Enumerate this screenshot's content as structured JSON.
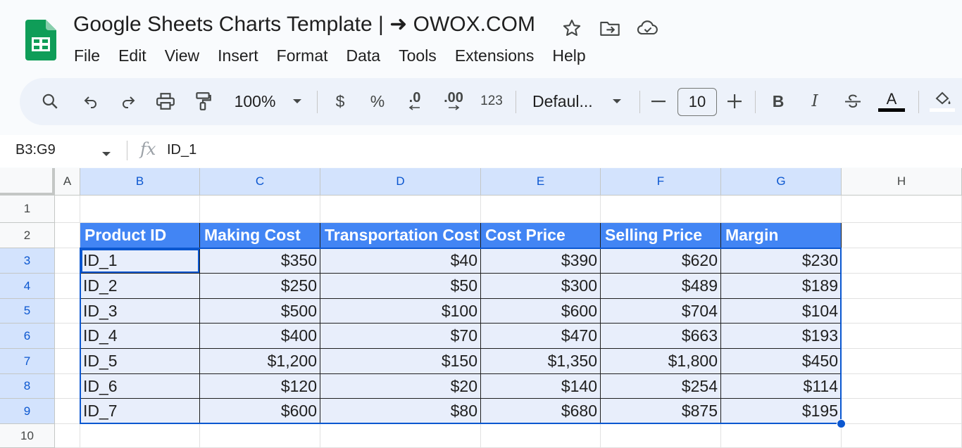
{
  "app": {
    "title": "Google Sheets Charts Template | ➜ OWOX.COM",
    "menu": [
      "File",
      "Edit",
      "View",
      "Insert",
      "Format",
      "Data",
      "Tools",
      "Extensions",
      "Help"
    ],
    "title_icons": [
      "star-icon",
      "move-to-folder-icon",
      "cloud-saved-icon"
    ]
  },
  "toolbar": {
    "zoom": "100%",
    "currency": "$",
    "percent": "%",
    "decrease_decimal": ".0",
    "increase_decimal": ".00",
    "number_format": "123",
    "font": "Defaul...",
    "font_size": "10",
    "bold": "B",
    "italic": "I",
    "text_color": "A"
  },
  "formula_bar": {
    "name_box": "B3:G9",
    "fx": "fx",
    "value": "ID_1"
  },
  "grid": {
    "columns": [
      "A",
      "B",
      "C",
      "D",
      "E",
      "F",
      "G",
      "H"
    ],
    "rows": [
      "1",
      "2",
      "3",
      "4",
      "5",
      "6",
      "7",
      "8",
      "9",
      "10"
    ],
    "selection": "B3:G9",
    "active_cell": "B3",
    "header_row": [
      "Product ID",
      "Making Cost",
      "Transportation Cost",
      "Cost Price",
      "Selling Price",
      "Margin"
    ],
    "data_rows": [
      [
        "ID_1",
        "$350",
        "$40",
        "$390",
        "$620",
        "$230"
      ],
      [
        "ID_2",
        "$250",
        "$50",
        "$300",
        "$489",
        "$189"
      ],
      [
        "ID_3",
        "$500",
        "$100",
        "$600",
        "$704",
        "$104"
      ],
      [
        "ID_4",
        "$400",
        "$70",
        "$470",
        "$663",
        "$193"
      ],
      [
        "ID_5",
        "$1,200",
        "$150",
        "$1,350",
        "$1,800",
        "$450"
      ],
      [
        "ID_6",
        "$120",
        "$20",
        "$140",
        "$254",
        "$114"
      ],
      [
        "ID_7",
        "$600",
        "$80",
        "$680",
        "$875",
        "$195"
      ]
    ]
  },
  "colors": {
    "header_fill": "#4285f4",
    "data_fill": "#e8eefb",
    "selection": "#0b57d0",
    "sheets_green": "#0f9d58"
  }
}
